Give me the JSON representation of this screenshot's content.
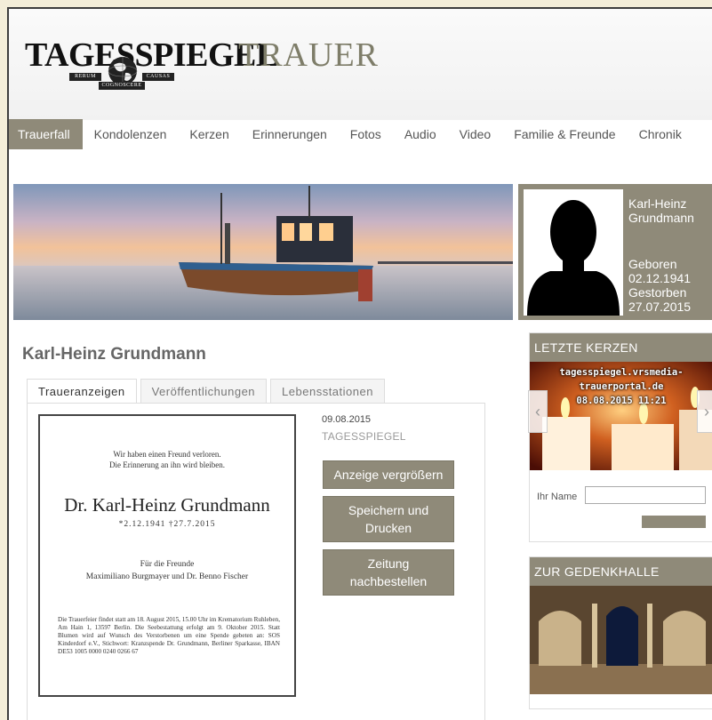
{
  "header": {
    "logo_main": "TAGESSPIEGEL",
    "logo_sub": "TRAUER",
    "logo_banner_left": "RERUM",
    "logo_banner_right": "CAUSAS",
    "logo_banner_bottom": "COGNOSCERE"
  },
  "nav": {
    "tabs": [
      "Trauerfall",
      "Kondolenzen",
      "Kerzen",
      "Erinnerungen",
      "Fotos",
      "Audio",
      "Video",
      "Familie & Freunde",
      "Chronik"
    ],
    "active": "Trauerfall"
  },
  "profile": {
    "name_line1": "Karl-Heinz",
    "name_line2": "Grundmann",
    "born_label": "Geboren",
    "born_date": "02.12.1941",
    "died_label": "Gestorben",
    "died_date": "27.07.2015"
  },
  "person_title": "Karl-Heinz Grundmann",
  "tabs": [
    "Traueranzeigen",
    "Veröffentlichungen",
    "Lebensstationen"
  ],
  "notice": {
    "lead_line1": "Wir haben einen Freund verloren.",
    "lead_line2": "Die Erinnerung an ihn wird bleiben.",
    "name": "Dr. Karl-Heinz Grundmann",
    "dates": "*2.12.1941     †27.7.2015",
    "friends_line1": "Für die Freunde",
    "friends_line2": "Maximiliano Burgmayer und Dr. Benno Fischer",
    "body": "Die Trauerfeier findet statt am 18. August 2015, 15.00 Uhr im Krematorium Ruhleben, Am Hain 1, 13597 Berlin. Die Seebestattung erfolgt am 9. Oktober 2015. Statt Blumen wird auf Wunsch des Verstorbenen um eine Spende gebeten an: SOS Kinderdorf e.V., Stichwort: Kranzspende Dr. Grundmann, Berliner Sparkasse, IBAN DE53 1005 0000 0240 0266 67",
    "pub_date": "09.08.2015",
    "pub_paper": "TAGESSPIEGEL"
  },
  "buttons": {
    "enlarge": "Anzeige vergrößern",
    "save_print": "Speichern und Drucken",
    "reorder": "Zeitung nachbestellen"
  },
  "sidebar": {
    "candles_title": "LETZTE KERZEN",
    "candle_line1": "tagesspiegel.vrsmedia-",
    "candle_line2": "trauerportal.de",
    "candle_line3": "08.08.2015 11:21",
    "name_label": "Ihr Name",
    "name_value": "",
    "hall_title": "ZUR GEDENKHALLE"
  },
  "colors": {
    "accent": "#8f8a79",
    "page_bg": "#f4eed9",
    "frame": "#3e3e3e"
  }
}
